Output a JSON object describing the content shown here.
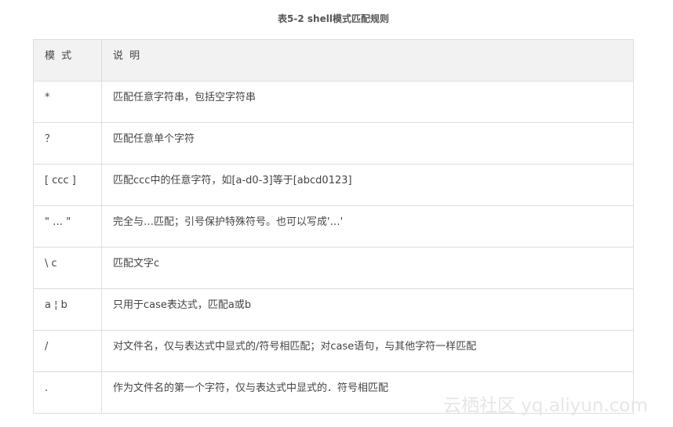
{
  "caption": "表5-2 shell模式匹配规则",
  "table": {
    "headers": [
      "模 式",
      "说 明"
    ],
    "rows": [
      {
        "pattern": "*",
        "desc": "匹配任意字符串，包括空字符串"
      },
      {
        "pattern": "？",
        "desc": "匹配任意单个字符"
      },
      {
        "pattern": "[ ccc ]",
        "desc": "匹配ccc中的任意字符，如[a-d0-3]等于[abcd0123]"
      },
      {
        "pattern": "\" … \"",
        "desc": "完全与…匹配；引号保护特殊符号。也可以写成'…'"
      },
      {
        "pattern": "\\ c",
        "desc": "匹配文字c"
      },
      {
        "pattern": "a ¦ b",
        "desc": "只用于case表达式，匹配a或b"
      },
      {
        "pattern": "/",
        "desc": "对文件名，仅与表达式中显式的/符号相匹配；对case语句，与其他字符一样匹配"
      },
      {
        "pattern": ".",
        "desc": "作为文件名的第一个字符，仅与表达式中显式的．符号相匹配"
      }
    ]
  },
  "watermark": "云栖社区 yq.aliyun.com"
}
